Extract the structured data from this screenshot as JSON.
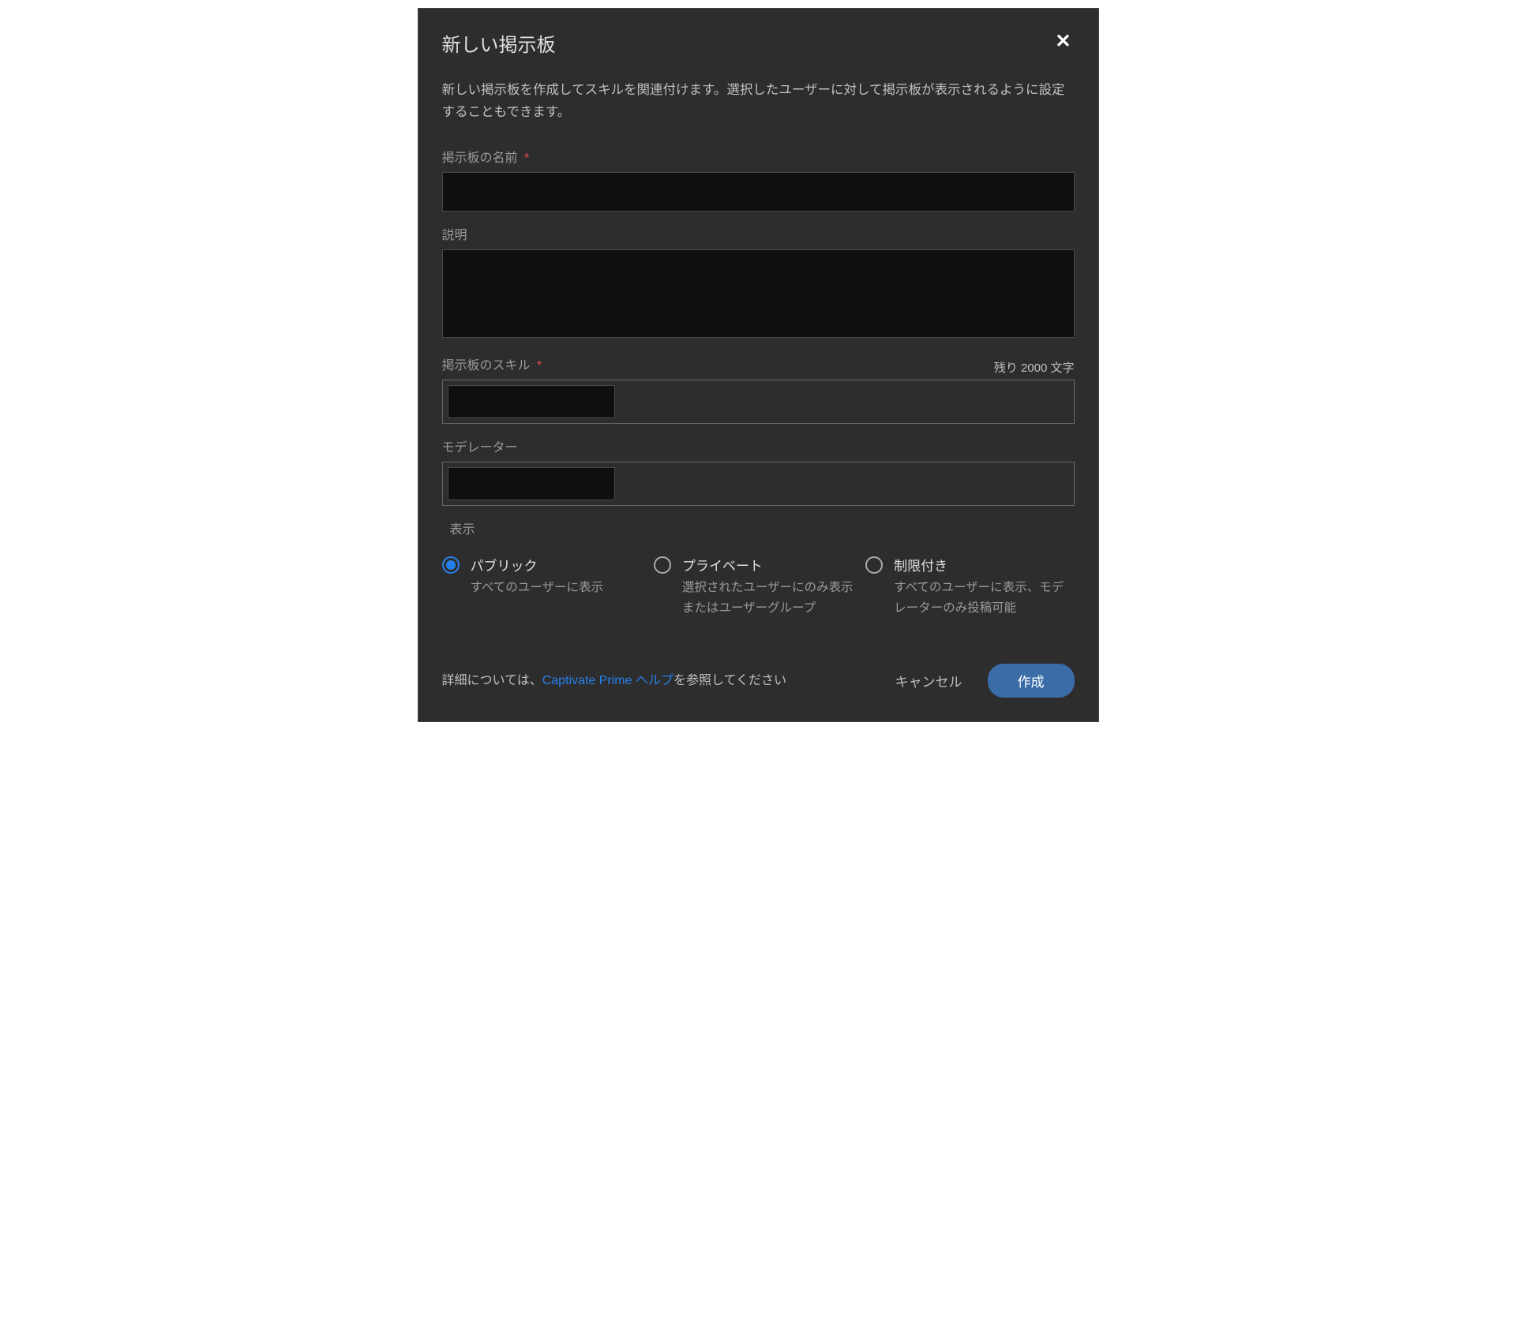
{
  "modal": {
    "title": "新しい掲示板",
    "description": "新しい掲示板を作成してスキルを関連付けます。選択したユーザーに対して掲示板が表示されるように設定することもできます。"
  },
  "form": {
    "board_name": {
      "label": "掲示板の名前",
      "value": ""
    },
    "description_field": {
      "label": "説明",
      "value": "",
      "remaining": "残り 2000 文字"
    },
    "board_skills": {
      "label": "掲示板のスキル"
    },
    "moderators": {
      "label": "モデレーター"
    },
    "visibility": {
      "label": "表示",
      "options": {
        "public": {
          "title": "パブリック",
          "desc": "すべてのユーザーに表示"
        },
        "private": {
          "title": "プライベート",
          "desc": "選択されたユーザーにのみ表示またはユーザーグループ"
        },
        "restricted": {
          "title": "制限付き",
          "desc": "すべてのユーザーに表示、モデレーターのみ投稿可能"
        }
      }
    }
  },
  "footer": {
    "help_prefix": "詳細については、",
    "help_link": "Captivate Prime ヘルプ",
    "help_suffix": "を参照してください",
    "cancel": "キャンセル",
    "create": "作成"
  }
}
